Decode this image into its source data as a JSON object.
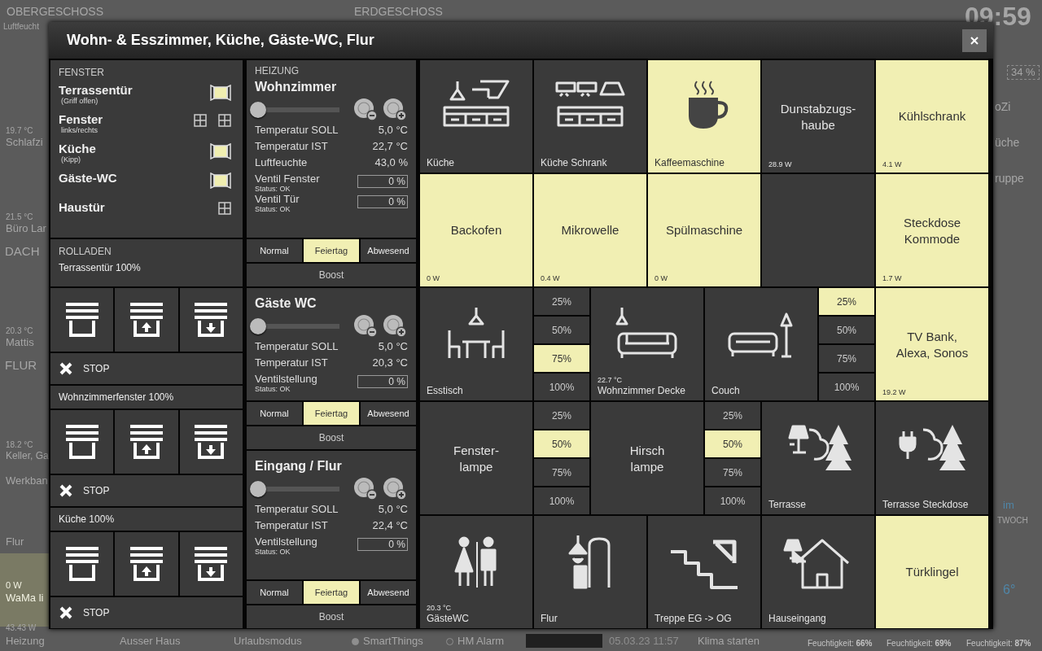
{
  "background": {
    "top": [
      "OBERGESCHOSS",
      "Luftfeucht",
      "ERDGESCHOSS",
      "09:59"
    ],
    "left_strip": [
      "19.7 °C",
      "Schlafzi",
      "21.5 °C",
      "Büro Lar",
      "DACH",
      "20.3 °C",
      "Mattis",
      "FLUR",
      "18.2 °C",
      "Keller, Ga",
      "Werkban",
      "Flur",
      "0 W",
      "WaMa li",
      "43.43 W",
      "Heizung"
    ],
    "bottom_bar": [
      {
        "kind": "text",
        "label": "Ausser Haus"
      },
      {
        "kind": "text",
        "label": "Urlaubsmodus"
      },
      {
        "kind": "radio",
        "label": "SmartThings",
        "selected": true
      },
      {
        "kind": "radio",
        "label": "HM Alarm",
        "selected": false
      },
      {
        "kind": "field",
        "label": "05.03.23 11:57"
      },
      {
        "kind": "text",
        "label": "Klima starten"
      },
      {
        "kind": "small",
        "label": "Feuchtigkeit: **66%**"
      },
      {
        "kind": "small",
        "label": "Feuchtigkeit: **69%**"
      },
      {
        "kind": "small",
        "label": "Feuchtigkeit: **87%**"
      }
    ],
    "right_strip": [
      "34 %",
      "oZi",
      "üche",
      "ruppe",
      "im",
      "TWOCH",
      "6°"
    ]
  },
  "dialog": {
    "title": "Wohn- & Esszimmer, Küche, Gäste-WC, Flur"
  },
  "fenster": {
    "heading": "FENSTER",
    "items": [
      {
        "name": "Terrassentür",
        "note": "(Griff offen)",
        "windows": [
          {
            "open": true
          }
        ]
      },
      {
        "name": "Fenster",
        "note": "links/rechts",
        "windows": [
          {
            "open": false
          },
          {
            "open": false
          }
        ]
      },
      {
        "name": "Küche",
        "note": "(Kipp)",
        "windows": [
          {
            "open": true
          }
        ]
      },
      {
        "name": "Gäste-WC",
        "windows": [
          {
            "open": true
          }
        ]
      },
      {
        "name": "Haustür",
        "windows": [
          {
            "open": false
          }
        ]
      }
    ]
  },
  "rolladen": {
    "heading": "ROLLADEN",
    "blinds": [
      {
        "label": "Terrassentür 100%",
        "stop": "STOP"
      },
      {
        "label": "Wohnzimmerfenster 100%",
        "stop": "STOP"
      },
      {
        "label": "Küche 100%",
        "stop": "STOP"
      }
    ]
  },
  "heizung": {
    "heading": "HEIZUNG",
    "rooms": [
      {
        "name": "Wohnzimmer",
        "level": 0,
        "rows": [
          {
            "kind": "value",
            "label": "Temperatur SOLL",
            "value": "5,0 °C"
          },
          {
            "kind": "value",
            "label": "Temperatur IST",
            "value": "22,7 °C"
          },
          {
            "kind": "value",
            "label": "Luftfeuchte",
            "value": "43,0 %"
          },
          {
            "kind": "valve",
            "label": "Ventil Fenster",
            "status": "Status: OK",
            "value": "0 %"
          },
          {
            "kind": "valve",
            "label": "Ventil Tür",
            "status": "Status: OK",
            "value": "0 %"
          }
        ],
        "modes": [
          {
            "label": "Normal",
            "selected": false
          },
          {
            "label": "Feiertag",
            "selected": true
          },
          {
            "label": "Abwesend",
            "selected": false
          }
        ],
        "boost": "Boost"
      },
      {
        "name": "Gäste WC",
        "level": 0,
        "rows": [
          {
            "kind": "value",
            "label": "Temperatur SOLL",
            "value": "5,0 °C"
          },
          {
            "kind": "value",
            "label": "Temperatur IST",
            "value": "20,3 °C"
          },
          {
            "kind": "valve",
            "label": "Ventilstellung",
            "status": "Status: OK",
            "value": "0 %"
          }
        ],
        "modes": [
          {
            "label": "Normal",
            "selected": false
          },
          {
            "label": "Feiertag",
            "selected": true
          },
          {
            "label": "Abwesend",
            "selected": false
          }
        ],
        "boost": "Boost"
      },
      {
        "name": "Eingang / Flur",
        "level": 0,
        "rows": [
          {
            "kind": "value",
            "label": "Temperatur SOLL",
            "value": "5,0 °C"
          },
          {
            "kind": "value",
            "label": "Temperatur IST",
            "value": "22,4 °C"
          },
          {
            "kind": "valve",
            "label": "Ventilstellung",
            "status": "Status: OK",
            "value": "0 %"
          }
        ],
        "modes": [
          {
            "label": "Normal",
            "selected": false
          },
          {
            "label": "Feiertag",
            "selected": true
          },
          {
            "label": "Abwesend",
            "selected": false
          }
        ],
        "boost": "Boost"
      }
    ]
  },
  "tiles": [
    {
      "kind": "icon",
      "label": "Küche",
      "on": false
    },
    {
      "kind": "icon",
      "label": "Küche Schrank",
      "on": false
    },
    {
      "kind": "icon",
      "label": "Kaffeemaschine",
      "on": true
    },
    {
      "kind": "text",
      "label": "Dunstabzugs-\nhaube",
      "reading": "28.9 W",
      "on": false
    },
    {
      "kind": "text",
      "label": "Kühlschrank",
      "reading": "4.1 W",
      "on": true
    },
    {
      "kind": "text",
      "label": "Backofen",
      "reading": "0 W",
      "on": true
    },
    {
      "kind": "text",
      "label": "Mikrowelle",
      "reading": "0.4 W",
      "on": true
    },
    {
      "kind": "text",
      "label": "Spülmaschine",
      "reading": "0 W",
      "on": true
    },
    {
      "kind": "blank",
      "on": false
    },
    {
      "kind": "text",
      "label": "Steckdose\nKommode",
      "reading": "1.7 W",
      "on": true
    },
    {
      "kind": "icon",
      "label": "Esstisch",
      "on": false
    },
    {
      "kind": "levels",
      "options": [
        {
          "label": "25%",
          "selected": false
        },
        {
          "label": "50%",
          "selected": false
        },
        {
          "label": "75%",
          "selected": true
        },
        {
          "label": "100%",
          "selected": false
        }
      ]
    },
    {
      "kind": "icon",
      "label": "Wohnzimmer Decke",
      "reading": "22.7 °C",
      "on": false
    },
    {
      "kind": "icon",
      "label": "Couch",
      "on": false
    },
    {
      "kind": "levels",
      "options": [
        {
          "label": "25%",
          "selected": true
        },
        {
          "label": "50%",
          "selected": false
        },
        {
          "label": "75%",
          "selected": false
        },
        {
          "label": "100%",
          "selected": false
        }
      ]
    },
    {
      "kind": "text",
      "label": "TV Bank,\nAlexa, Sonos",
      "reading": "19.2 W",
      "on": true
    },
    {
      "kind": "text",
      "label": "Fenster-\nlampe",
      "on": false
    },
    {
      "kind": "levels",
      "options": [
        {
          "label": "25%",
          "selected": false
        },
        {
          "label": "50%",
          "selected": true
        },
        {
          "label": "75%",
          "selected": false
        },
        {
          "label": "100%",
          "selected": false
        }
      ]
    },
    {
      "kind": "text",
      "label": "Hirsch\nlampe",
      "on": false
    },
    {
      "kind": "levels",
      "options": [
        {
          "label": "25%",
          "selected": false
        },
        {
          "label": "50%",
          "selected": true
        },
        {
          "label": "75%",
          "selected": false
        },
        {
          "label": "100%",
          "selected": false
        }
      ]
    },
    {
      "kind": "icon",
      "label": "Terrasse",
      "on": false
    },
    {
      "kind": "icon",
      "label": "Terrasse Steckdose",
      "on": false
    },
    {
      "kind": "icon",
      "label": "GästeWC",
      "reading": "20.3 °C",
      "on": false
    },
    {
      "kind": "icon",
      "label": "Flur",
      "on": false
    },
    {
      "kind": "icon",
      "label": "Treppe EG -> OG",
      "on": false
    },
    {
      "kind": "icon",
      "label": "Hauseingang",
      "on": false
    },
    {
      "kind": "text",
      "label": "Türklingel",
      "on": true
    }
  ]
}
